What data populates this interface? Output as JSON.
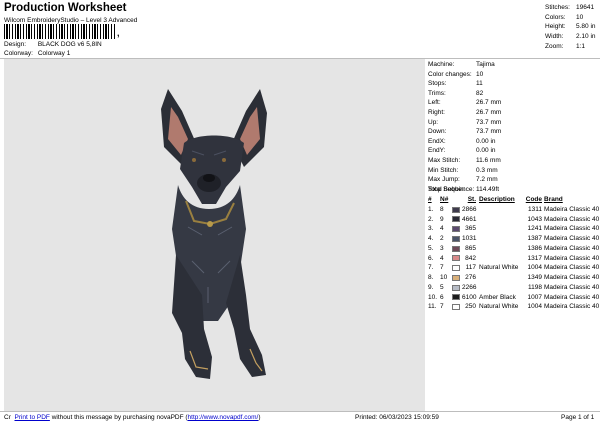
{
  "header": {
    "title": "Production Worksheet",
    "subtitle": "Wilcom EmbroideryStudio – Level 3 Advanced",
    "barcode_mark": ",",
    "design_label": "Design:",
    "design_value": "BLACK DOG v6 5,8IN",
    "colorway_label": "Colorway:",
    "colorway_value": "Colorway 1"
  },
  "stats": [
    {
      "label": "Stitches:",
      "value": "19641"
    },
    {
      "label": "Colors:",
      "value": "10"
    },
    {
      "label": "Height:",
      "value": "5.80 in"
    },
    {
      "label": "Width:",
      "value": "2.10 in"
    },
    {
      "label": "Zoom:",
      "value": "1:1"
    }
  ],
  "machine_info": [
    {
      "label": "Machine:",
      "value": "Tajima"
    },
    {
      "label": "Color changes:",
      "value": "10"
    },
    {
      "label": "Stops:",
      "value": "11"
    },
    {
      "label": "Trims:",
      "value": "82"
    },
    {
      "label": "Left:",
      "value": "26.7 mm"
    },
    {
      "label": "Right:",
      "value": "26.7 mm"
    },
    {
      "label": "Up:",
      "value": "73.7 mm"
    },
    {
      "label": "Down:",
      "value": "73.7 mm"
    },
    {
      "label": "EndX:",
      "value": "0.00 in"
    },
    {
      "label": "EndY:",
      "value": "0.00 in"
    },
    {
      "label": "Max Stitch:",
      "value": "11.6 mm"
    },
    {
      "label": "Min Stitch:",
      "value": "0.3 mm"
    },
    {
      "label": "Max Jump:",
      "value": "7.2 mm"
    },
    {
      "label": "Total Bobbin:",
      "value": "114.49ft"
    }
  ],
  "stop_sequence": {
    "title": "Stop Sequence:",
    "headers": {
      "num": "#",
      "n": "N#",
      "st": "St.",
      "desc": "Description",
      "code": "Code",
      "brand": "Brand"
    },
    "rows": [
      {
        "num": "1.",
        "n": "8",
        "color": "#3e3a4c",
        "st": "2866",
        "desc": "",
        "code": "1311",
        "brand": "Madeira Classic 40"
      },
      {
        "num": "2.",
        "n": "9",
        "color": "#2a2a35",
        "st": "4661",
        "desc": "",
        "code": "1043",
        "brand": "Madeira Classic 40"
      },
      {
        "num": "3.",
        "n": "4",
        "color": "#5b4a6e",
        "st": "365",
        "desc": "",
        "code": "1241",
        "brand": "Madeira Classic 40"
      },
      {
        "num": "4.",
        "n": "2",
        "color": "#4a5468",
        "st": "1031",
        "desc": "",
        "code": "1387",
        "brand": "Madeira Classic 40"
      },
      {
        "num": "5.",
        "n": "3",
        "color": "#6e4a58",
        "st": "865",
        "desc": "",
        "code": "1386",
        "brand": "Madeira Classic 40"
      },
      {
        "num": "6.",
        "n": "4",
        "color": "#d98a8a",
        "st": "842",
        "desc": "",
        "code": "1317",
        "brand": "Madeira Classic 40"
      },
      {
        "num": "7.",
        "n": "7",
        "color": "#ffffff",
        "st": "117",
        "desc": "Natural White",
        "code": "1004",
        "brand": "Madeira Classic 40"
      },
      {
        "num": "8.",
        "n": "10",
        "color": "#d9b07a",
        "st": "276",
        "desc": "",
        "code": "1349",
        "brand": "Madeira Classic 40"
      },
      {
        "num": "9.",
        "n": "5",
        "color": "#b7bcc6",
        "st": "2266",
        "desc": "",
        "code": "1198",
        "brand": "Madeira Classic 40"
      },
      {
        "num": "10.",
        "n": "6",
        "color": "#1c1c1c",
        "st": "6100",
        "desc": "Amber Black",
        "code": "1007",
        "brand": "Madeira Classic 40"
      },
      {
        "num": "11.",
        "n": "7",
        "color": "#ffffff",
        "st": "250",
        "desc": "Natural White",
        "code": "1004",
        "brand": "Madeira Classic 40"
      }
    ]
  },
  "footer": {
    "prefix": "Cr",
    "link1": "Print to PDF",
    "middle": "without this message by purchasing novaPDF (",
    "link2": "http://www.novapdf.com/",
    "suffix": ")",
    "printed": "Printed:  06/03/2023 15:09:59",
    "page": "Page 1 of 1"
  },
  "colors": {
    "canvas_bg": "#e5e5e5",
    "link": "#0000cc"
  }
}
